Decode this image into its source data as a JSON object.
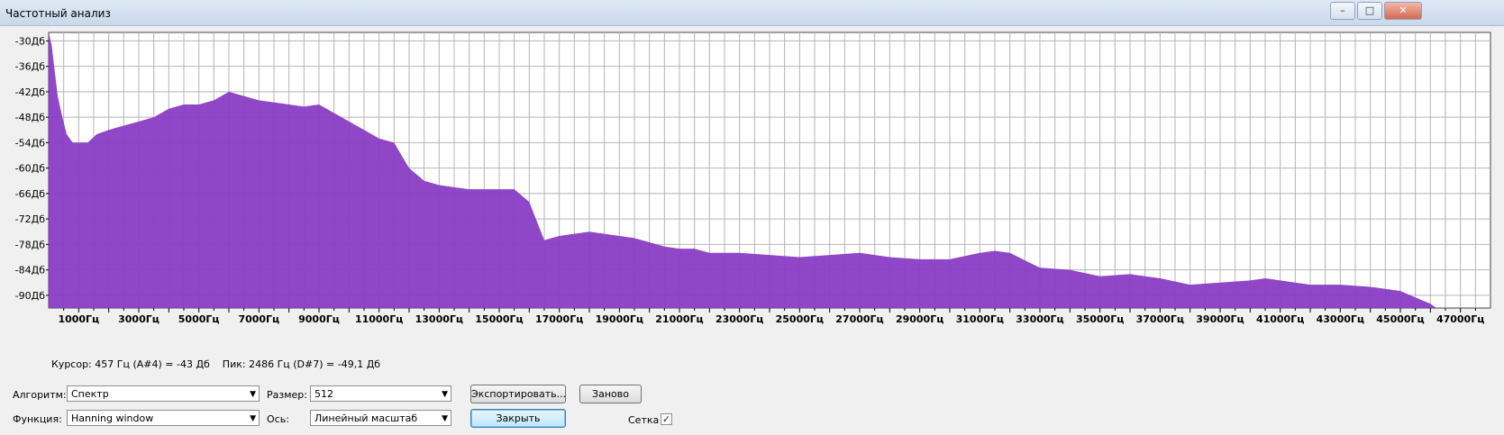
{
  "window": {
    "title": "Частотный анализ",
    "min_icon": "minimize-icon",
    "max_icon": "maximize-icon",
    "close_icon": "close-icon"
  },
  "status": {
    "text": "Курсор: 457 Гц (A#4) = -43 Дб    Пик: 2486 Гц (D#7) = -49,1 Дб"
  },
  "controls": {
    "algorithm_label": "Алгоритм:",
    "algorithm_value": "Спектр",
    "function_label": "Функция:",
    "function_value": "Hanning window",
    "size_label": "Размер:",
    "size_value": "512",
    "axis_label": "Ось:",
    "axis_value": "Линейный масштаб",
    "export_button": "Экспортировать...",
    "reset_button": "Заново",
    "close_button": "Закрыть",
    "grid_label": "Сетка",
    "grid_checked": true
  },
  "chart_data": {
    "type": "area",
    "xlim": [
      0,
      48000
    ],
    "ylim": [
      -93,
      -28
    ],
    "grid": true,
    "fill_color": "#8a3dc4",
    "x_ticks": [
      "1000Гц",
      "3000Гц",
      "5000Гц",
      "7000Гц",
      "9000Гц",
      "11000Гц",
      "13000Гц",
      "15000Гц",
      "17000Гц",
      "19000Гц",
      "21000Гц",
      "23000Гц",
      "25000Гц",
      "27000Гц",
      "29000Гц",
      "31000Гц",
      "33000Гц",
      "35000Гц",
      "37000Гц",
      "39000Гц",
      "41000Гц",
      "43000Гц",
      "45000Гц",
      "47000Гц"
    ],
    "y_ticks": [
      "-30Дб",
      "-36Дб",
      "-42Дб",
      "-48Дб",
      "-54Дб",
      "-60Дб",
      "-66Дб",
      "-72Дб",
      "-78Дб",
      "-84Дб",
      "-90Дб"
    ],
    "x": [
      0,
      100,
      200,
      300,
      457,
      600,
      800,
      1000,
      1300,
      1600,
      2000,
      2486,
      3000,
      3500,
      4000,
      4500,
      5000,
      5500,
      6000,
      6500,
      7000,
      7500,
      8000,
      8500,
      9000,
      9500,
      10000,
      10500,
      11000,
      11500,
      12000,
      12500,
      13000,
      13500,
      14000,
      14500,
      15000,
      15500,
      16000,
      16500,
      17000,
      17500,
      18000,
      18500,
      19000,
      19500,
      20000,
      20500,
      21000,
      21500,
      22000,
      23000,
      24000,
      25000,
      26000,
      27000,
      28000,
      29000,
      30000,
      31000,
      31500,
      32000,
      33000,
      34000,
      35000,
      36000,
      37000,
      38000,
      39000,
      40000,
      40500,
      41000,
      42000,
      43000,
      44000,
      45000,
      45500,
      46000,
      46200
    ],
    "y": [
      -28,
      -31,
      -37,
      -43,
      -48,
      -52,
      -54,
      -54,
      -54,
      -52,
      -51,
      -50,
      -49,
      -48,
      -46,
      -45,
      -45,
      -44,
      -42,
      -43,
      -44,
      -44.5,
      -45,
      -45.5,
      -45,
      -47,
      -49,
      -51,
      -53,
      -54,
      -60,
      -63,
      -64,
      -64.5,
      -65,
      -65,
      -65,
      -65,
      -68,
      -77,
      -76,
      -75.5,
      -75,
      -75.5,
      -76,
      -76.5,
      -77.5,
      -78.5,
      -79,
      -79,
      -80,
      -80,
      -80.5,
      -81,
      -80.5,
      -80,
      -81,
      -81.5,
      -81.5,
      -80,
      -79.5,
      -80,
      -83.5,
      -84,
      -85.5,
      -85,
      -86,
      -87.5,
      -87,
      -86.5,
      -86,
      -86.5,
      -87.5,
      -87.5,
      -88,
      -89,
      -90.5,
      -92,
      -93
    ]
  }
}
